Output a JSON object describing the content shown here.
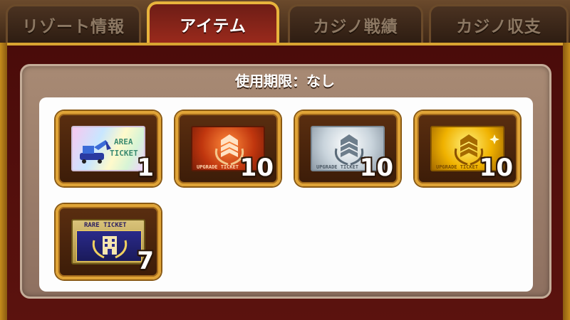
{
  "tabs": [
    {
      "label": "リゾート情報",
      "active": false
    },
    {
      "label": "アイテム",
      "active": true
    },
    {
      "label": "カジノ戦績",
      "active": false
    },
    {
      "label": "カジノ収支",
      "active": false
    }
  ],
  "expiry": {
    "text": "使用期限：なし"
  },
  "items": [
    {
      "name": "area-ticket",
      "ticket_text": [
        "AREA",
        "TICKET"
      ],
      "count": "1"
    },
    {
      "name": "bronze-upgrade-ticket",
      "ticket_text": "UPGRADE TICKET",
      "count": "10"
    },
    {
      "name": "silver-upgrade-ticket",
      "ticket_text": "UPGRADE TICKET",
      "count": "10"
    },
    {
      "name": "gold-upgrade-ticket",
      "ticket_text": "UPGRADE TICKET",
      "count": "10"
    },
    {
      "name": "rare-ticket",
      "ticket_text": "RARE TICKET",
      "count": "7"
    }
  ],
  "colors": {
    "accent_gold": "#e0a437",
    "active_tab": "#9b2a1c",
    "frame": "#4a0c0a"
  }
}
